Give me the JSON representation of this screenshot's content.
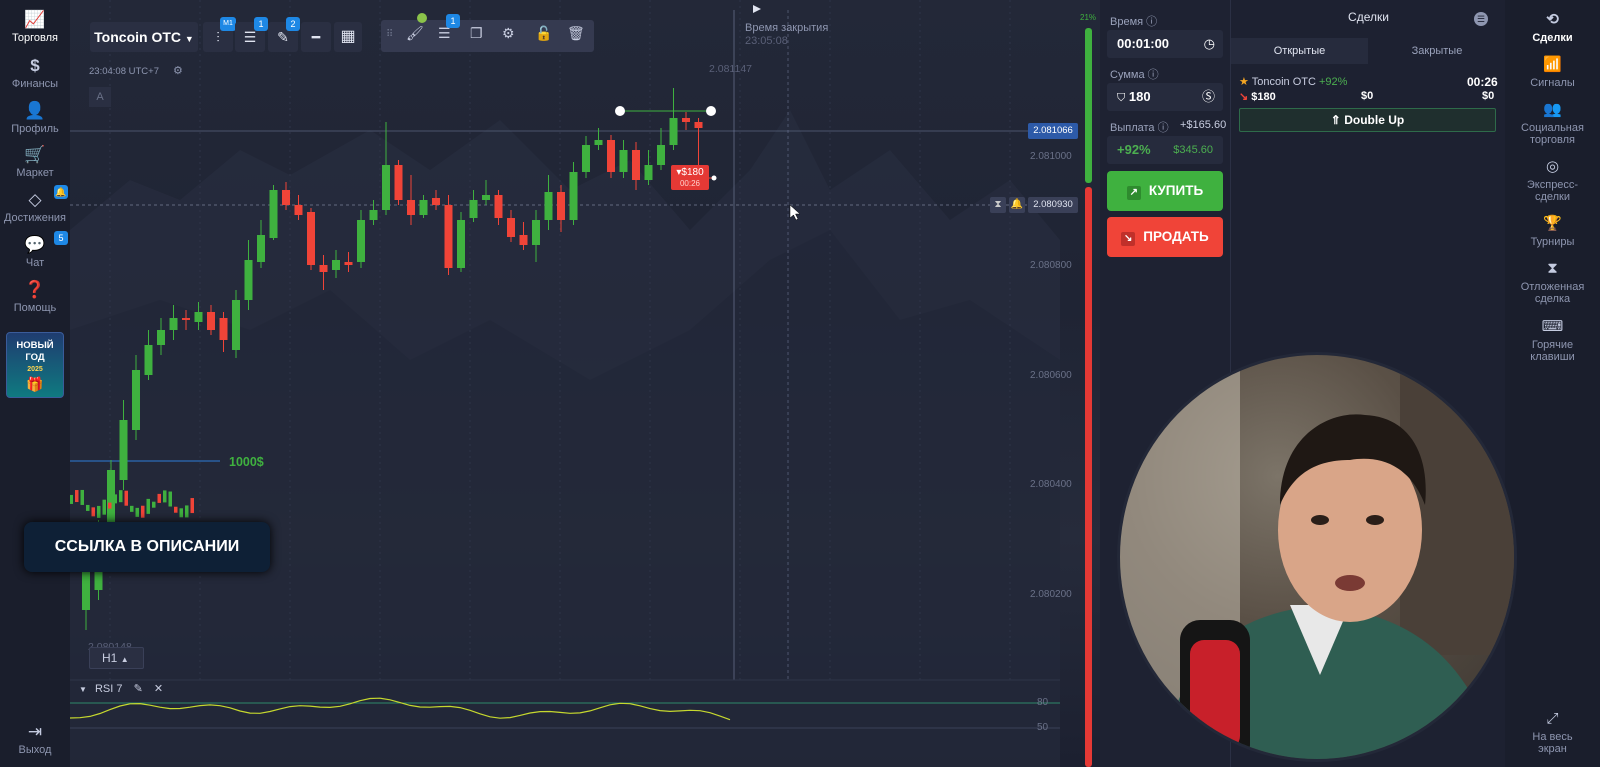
{
  "left_nav": {
    "items": [
      {
        "label": "Торговля",
        "icon": "chart-line-icon"
      },
      {
        "label": "Финансы",
        "icon": "dollar-icon"
      },
      {
        "label": "Профиль",
        "icon": "user-icon"
      },
      {
        "label": "Маркет",
        "icon": "cart-icon"
      },
      {
        "label": "Достижения",
        "icon": "diamond-icon"
      },
      {
        "label": "Чат",
        "icon": "chat-icon"
      },
      {
        "label": "Помощь",
        "icon": "help-icon"
      }
    ],
    "badge_chat": "5",
    "promo_line1": "НОВЫЙ",
    "promo_line2": "ГОД",
    "promo_line3": "2025",
    "exit_label": "Выход"
  },
  "toolbar": {
    "asset": "Toncoin OTC",
    "timeframe_badge": "M1",
    "indicators_badge": "1",
    "drawings_badge": "2",
    "layers_badge": "1"
  },
  "chart": {
    "time_label": "23:04:08 UTC+7",
    "close_time_title": "Время закрытия",
    "close_time_value": "23:05:08",
    "high_label": "2.081147",
    "low_label": "2.080148",
    "current_price": "2.081066",
    "strike_price": "2.080930",
    "trade_marker_amount": "▾$180",
    "trade_marker_time": "00:26",
    "price_axis": [
      "2.081000",
      "2.080800",
      "2.080600",
      "2.080400",
      "2.080200"
    ],
    "bet_line_label": "1000$",
    "overlay_banner": "ССЫЛКА В ОПИСАНИИ",
    "timeframe": "H1",
    "indicator_name": "RSI 7",
    "rsi_axis": [
      "80",
      "50"
    ],
    "volume_pct": "21%",
    "a_button": "A"
  },
  "order_panel": {
    "time_label": "Время",
    "time_value": "00:01:00",
    "amount_label": "Сумма",
    "amount_value": "180",
    "payout_label": "Выплата",
    "payout_profit": "+$165.60",
    "payout_percent": "+92%",
    "payout_total": "$345.60",
    "buy_label": "КУПИТЬ",
    "sell_label": "ПРОДАТЬ"
  },
  "trades": {
    "title": "Сделки",
    "tab_open": "Открытые",
    "tab_closed": "Закрытые",
    "item": {
      "asset": "Toncoin OTC",
      "percent": "+92%",
      "timer": "00:26",
      "amount": "$180",
      "value1": "$0",
      "value2": "$0"
    },
    "double_up_label": "Double Up"
  },
  "right_nav": {
    "items": [
      {
        "label": "Сделки",
        "icon": "history-icon"
      },
      {
        "label": "Сигналы",
        "icon": "signal-icon"
      },
      {
        "label": "Социальная торговля",
        "icon": "social-icon"
      },
      {
        "label": "Экспресс-сделки",
        "icon": "express-icon"
      },
      {
        "label": "Турниры",
        "icon": "trophy-icon"
      },
      {
        "label": "Отложенная сделка",
        "icon": "hourglass-icon"
      },
      {
        "label": "Горячие клавиши",
        "icon": "keyboard-icon"
      }
    ],
    "fullscreen_label": "На весь экран"
  },
  "colors": {
    "green": "#3fb13f",
    "red": "#f04438",
    "accent": "#1e88e5"
  }
}
